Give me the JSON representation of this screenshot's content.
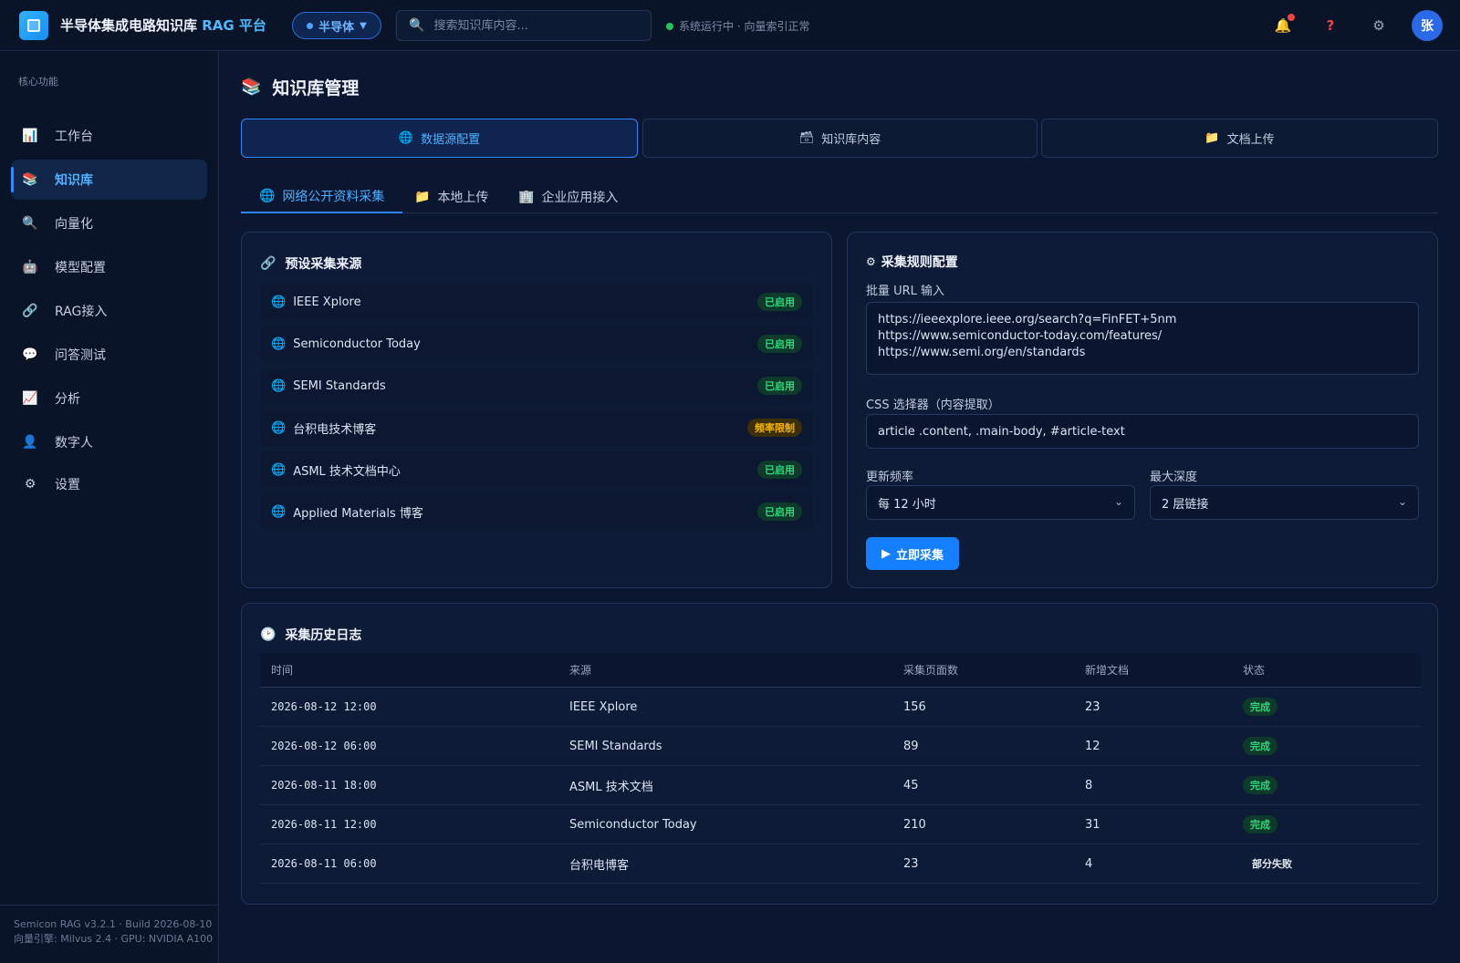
{
  "header": {
    "title_main": "半导体集成电路知识库 ",
    "title_accent": "RAG 平台",
    "domain_selector": "半导体",
    "search_placeholder": "搜索知识库内容...",
    "status_text": "系统运行中 · 向量索引正常",
    "avatar_text": "张",
    "colors": {
      "accent": "#1480ff",
      "status_ok": "#22c55e",
      "notification": "#ef4444"
    }
  },
  "sidebar": {
    "section_label": "核心功能",
    "items": [
      {
        "label": "工作台",
        "icon": "chart-icon",
        "glyph": "📊"
      },
      {
        "label": "知识库",
        "icon": "books-icon",
        "glyph": "📚"
      },
      {
        "label": "向量化",
        "icon": "search-icon",
        "glyph": "🔍"
      },
      {
        "label": "模型配置",
        "icon": "robot-icon",
        "glyph": "🤖"
      },
      {
        "label": "RAG接入",
        "icon": "link-icon",
        "glyph": "🔗"
      },
      {
        "label": "问答测试",
        "icon": "chat-icon",
        "glyph": "💬"
      },
      {
        "label": "分析",
        "icon": "trend-icon",
        "glyph": "📈"
      },
      {
        "label": "数字人",
        "icon": "person-icon",
        "glyph": "👤"
      },
      {
        "label": "设置",
        "icon": "gear-icon",
        "glyph": "⚙"
      }
    ],
    "footer_line1": "Semicon RAG v3.2.1 · Build 2026-08-10",
    "footer_line2": "向量引擎: Milvus 2.4 · GPU: NVIDIA A100"
  },
  "page": {
    "title": "知识库管理",
    "main_tabs": [
      {
        "label": "数据源配置",
        "icon": "globe-icon",
        "glyph": "🌐"
      },
      {
        "label": "知识库内容",
        "icon": "card-index-icon",
        "glyph": "🗃"
      },
      {
        "label": "文档上传",
        "icon": "folder-icon",
        "glyph": "📁"
      }
    ],
    "sub_tabs": [
      {
        "label": "网络公开资料采集",
        "icon": "globe-icon",
        "glyph": "🌐"
      },
      {
        "label": "本地上传",
        "icon": "folder-icon",
        "glyph": "📁"
      },
      {
        "label": "企业应用接入",
        "icon": "building-icon",
        "glyph": "🏢"
      }
    ]
  },
  "sources": {
    "title": "预设采集来源",
    "items": [
      {
        "name": "IEEE Xplore",
        "status": "已启用",
        "kind": "ok"
      },
      {
        "name": "Semiconductor Today",
        "status": "已启用",
        "kind": "ok"
      },
      {
        "name": "SEMI Standards",
        "status": "已启用",
        "kind": "ok"
      },
      {
        "name": "台积电技术博客",
        "status": "频率限制",
        "kind": "warn"
      },
      {
        "name": "ASML 技术文档中心",
        "status": "已启用",
        "kind": "ok"
      },
      {
        "name": "Applied Materials 博客",
        "status": "已启用",
        "kind": "ok"
      }
    ]
  },
  "rules": {
    "title": "采集规则配置",
    "url_label": "批量 URL 输入",
    "url_value": "https://ieeexplore.ieee.org/search?q=FinFET+5nm\nhttps://www.semiconductor-today.com/features/\nhttps://www.semi.org/en/standards",
    "css_label": "CSS 选择器（内容提取）",
    "css_value": "article .content, .main-body, #article-text",
    "freq_label": "更新频率",
    "freq_value": "每 12 小时",
    "depth_label": "最大深度",
    "depth_value": "2 层链接",
    "run_button": "立即采集"
  },
  "history": {
    "title": "采集历史日志",
    "columns": [
      "时间",
      "来源",
      "采集页面数",
      "新增文档",
      "状态"
    ],
    "rows": [
      {
        "time": "2026-08-12 12:00",
        "source": "IEEE Xplore",
        "pages": "156",
        "new_docs": "23",
        "status": "完成",
        "kind": "ok"
      },
      {
        "time": "2026-08-12 06:00",
        "source": "SEMI Standards",
        "pages": "89",
        "new_docs": "12",
        "status": "完成",
        "kind": "ok"
      },
      {
        "time": "2026-08-11 18:00",
        "source": "ASML 技术文档",
        "pages": "45",
        "new_docs": "8",
        "status": "完成",
        "kind": "ok"
      },
      {
        "time": "2026-08-11 12:00",
        "source": "Semiconductor Today",
        "pages": "210",
        "new_docs": "31",
        "status": "完成",
        "kind": "ok"
      },
      {
        "time": "2026-08-11 06:00",
        "source": "台积电博客",
        "pages": "23",
        "new_docs": "4",
        "status": "部分失败",
        "kind": "partial"
      }
    ]
  }
}
